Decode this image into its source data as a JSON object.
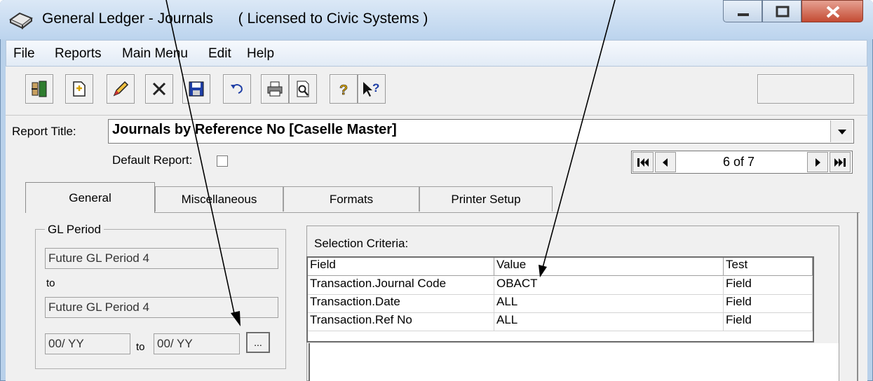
{
  "window": {
    "title": "General Ledger - Journals",
    "license": "( Licensed to Civic Systems )"
  },
  "menu": [
    "File",
    "Reports",
    "Main Menu",
    "Edit",
    "Help"
  ],
  "toolbar": {
    "icons": [
      "exit-icon",
      "new-icon",
      "edit-pencil-icon",
      "delete-icon",
      "save-icon",
      "undo-icon",
      "print-icon",
      "print-preview-icon",
      "help-icon",
      "context-help-icon"
    ]
  },
  "report": {
    "title_label": "Report Title:",
    "title_value": "Journals by Reference No [Caselle Master]",
    "default_label": "Default Report:",
    "default_checked": false,
    "nav_position": "6 of 7"
  },
  "tabs": [
    "General",
    "Miscellaneous",
    "Formats",
    "Printer Setup"
  ],
  "active_tab": "General",
  "gl_period": {
    "group_label": "GL Period",
    "from": "Future GL Period 4",
    "to_label": "to",
    "to": "Future GL Period 4",
    "date_from": "00/ YY",
    "date_to_label": "to",
    "date_to": "00/ YY",
    "browse_label": "..."
  },
  "selection": {
    "label": "Selection Criteria:",
    "columns": [
      "Field",
      "Value",
      "Test"
    ],
    "rows": [
      [
        "Transaction.Journal Code",
        "OBACT",
        "Field"
      ],
      [
        "Transaction.Date",
        "ALL",
        "Field"
      ],
      [
        "Transaction.Ref No",
        "ALL",
        "Field"
      ]
    ]
  },
  "colors": {
    "title_bar": "#bcd4ee",
    "close_button": "#c44b33",
    "panel": "#f0f0f0"
  }
}
